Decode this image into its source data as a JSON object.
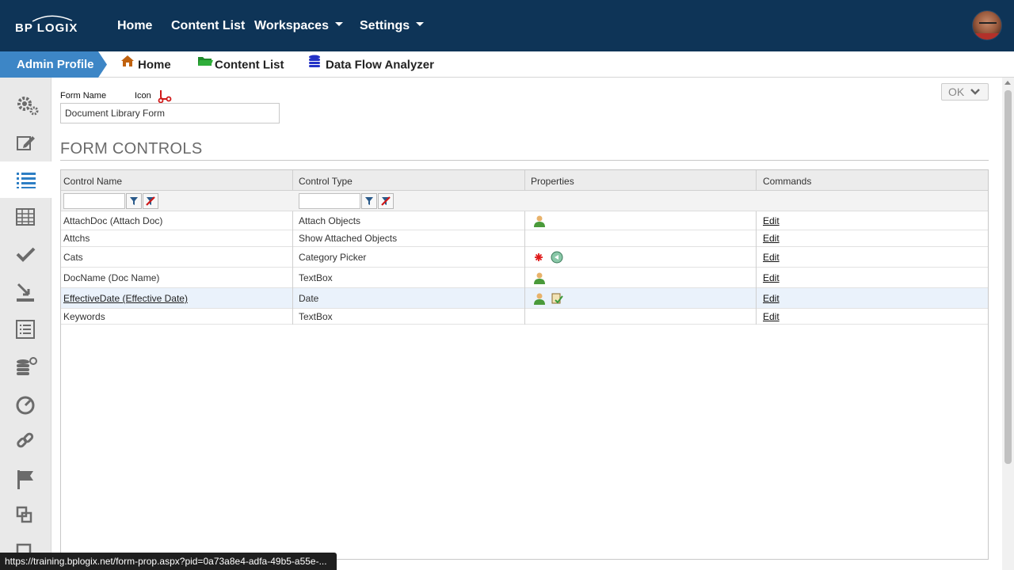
{
  "topbar": {
    "logo": "BPLOGIX",
    "nav": [
      {
        "label": "Home"
      },
      {
        "label": "Content List"
      },
      {
        "label": "Workspaces"
      },
      {
        "label": "Settings"
      }
    ]
  },
  "subbar": {
    "admin_label": "Admin Profile",
    "links": [
      {
        "label": "Home",
        "icon": "house-icon"
      },
      {
        "label": "Content List",
        "icon": "folder-icon"
      },
      {
        "label": "Data Flow Analyzer",
        "icon": "database-icon"
      }
    ]
  },
  "sidebar": {
    "items": [
      {
        "icon": "gears-icon"
      },
      {
        "icon": "edit-icon"
      },
      {
        "icon": "list-icon",
        "active": true
      },
      {
        "icon": "table-icon"
      },
      {
        "icon": "check-icon"
      },
      {
        "icon": "download-icon"
      },
      {
        "icon": "form-list-icon"
      },
      {
        "icon": "database-add-icon"
      },
      {
        "icon": "dashboard-icon"
      },
      {
        "icon": "link-icon"
      },
      {
        "icon": "flag-icon"
      },
      {
        "icon": "copy-icon"
      },
      {
        "icon": "document-icon"
      }
    ]
  },
  "form": {
    "name_label": "Form Name",
    "icon_label": "Icon",
    "name_value": "Document Library Form",
    "ok_label": "OK"
  },
  "section": {
    "title": "FORM CONTROLS"
  },
  "grid": {
    "columns": [
      "Control Name",
      "Control Type",
      "Properties",
      "Commands"
    ],
    "rows": [
      {
        "name": "AttachDoc (Attach Doc)",
        "type": "Attach Objects",
        "props": [
          "user-icon"
        ],
        "command": "Edit"
      },
      {
        "name": "Attchs",
        "type": "Show Attached Objects",
        "props": [],
        "command": "Edit"
      },
      {
        "name": "Cats",
        "type": "Category Picker",
        "props": [
          "required-icon",
          "globe-icon"
        ],
        "command": "Edit"
      },
      {
        "name": "DocName (Doc Name)",
        "type": "TextBox",
        "props": [
          "user-icon"
        ],
        "command": "Edit"
      },
      {
        "name": "EffectiveDate (Effective Date)",
        "type": "Date",
        "props": [
          "user-icon",
          "script-icon"
        ],
        "command": "Edit",
        "selected": true
      },
      {
        "name": "Keywords",
        "type": "TextBox",
        "props": [],
        "command": "Edit"
      }
    ]
  },
  "status": {
    "url": "https://training.bplogix.net/form-prop.aspx?pid=0a73a8e4-adfa-49b5-a55e-..."
  },
  "colors": {
    "topbar": "#0e3457",
    "admin_tab": "#3d86c6",
    "sidebar": "#e9e9e9"
  }
}
